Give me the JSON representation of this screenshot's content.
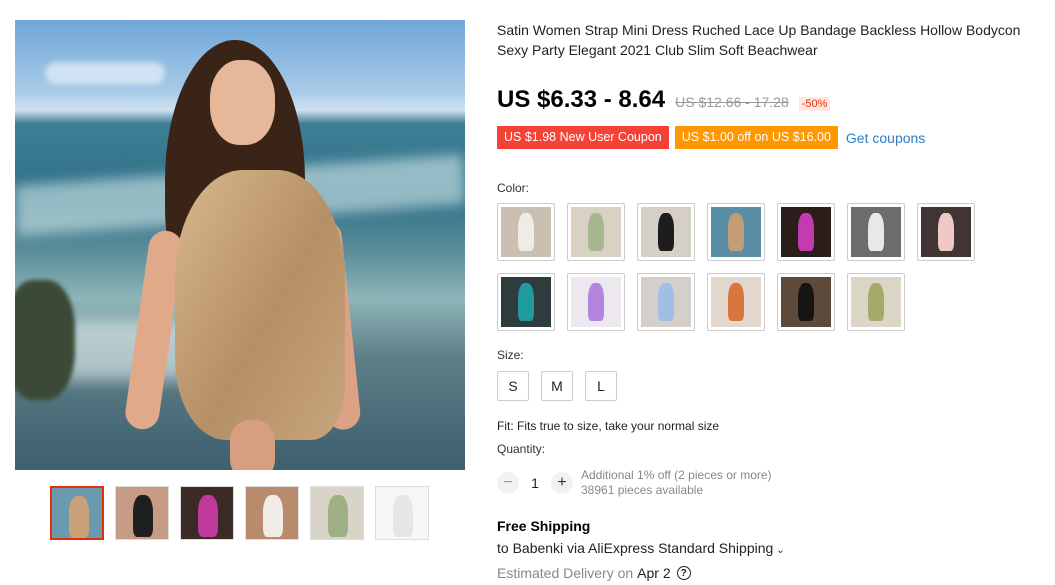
{
  "product": {
    "title": "Satin Women Strap Mini Dress Ruched Lace Up Bandage Backless Hollow Bodycon Sexy Party Elegant 2021 Club Slim Soft Beachwear",
    "price": "US $6.33 - 8.64",
    "original_price": "US $12.66 - 17.28",
    "discount": "-50%"
  },
  "coupons": {
    "new_user": "US $1.98 New User Coupon",
    "store": "US $1.00 off on US $16.00",
    "get_coupons": "Get coupons"
  },
  "gallery": {
    "thumbnails": [
      {
        "name": "champagne",
        "color": "#c9a27a",
        "bg": "#6a9ab0",
        "selected": true
      },
      {
        "name": "black-lounge",
        "color": "#1f1f1f",
        "bg": "#c79c86",
        "selected": false
      },
      {
        "name": "pink-night",
        "color": "#c03a9e",
        "bg": "#3b2a26",
        "selected": false
      },
      {
        "name": "white-room",
        "color": "#f1ece6",
        "bg": "#b98b6e",
        "selected": false
      },
      {
        "name": "sage",
        "color": "#9fb084",
        "bg": "#d8d4c8",
        "selected": false
      },
      {
        "name": "size-chart",
        "color": "#e6e6e6",
        "bg": "#f7f7f7",
        "selected": false
      }
    ]
  },
  "color": {
    "label": "Color:",
    "swatches": [
      {
        "name": "white",
        "color": "#efece6",
        "bg": "#cbbfb2"
      },
      {
        "name": "sage",
        "color": "#a8b88e",
        "bg": "#d9d2c4"
      },
      {
        "name": "black",
        "color": "#1d1d1d",
        "bg": "#d5cfc6"
      },
      {
        "name": "champagne-beach",
        "color": "#c29c74",
        "bg": "#5a8ea6"
      },
      {
        "name": "hot-pink",
        "color": "#c23bb0",
        "bg": "#2b1e1a"
      },
      {
        "name": "silver-white",
        "color": "#e8e8e8",
        "bg": "#6c6c6c"
      },
      {
        "name": "light-pink",
        "color": "#efc9c6",
        "bg": "#403532"
      },
      {
        "name": "teal",
        "color": "#1f9aa0",
        "bg": "#2f3b3d"
      },
      {
        "name": "lavender",
        "color": "#b184e0",
        "bg": "#ece8ee"
      },
      {
        "name": "light-blue",
        "color": "#9fc0e4",
        "bg": "#d4cfcb"
      },
      {
        "name": "orange",
        "color": "#d8753d",
        "bg": "#e1d7cd"
      },
      {
        "name": "black-party",
        "color": "#151515",
        "bg": "#5e4a3c"
      },
      {
        "name": "olive",
        "color": "#a4ab6b",
        "bg": "#dcd6c7"
      }
    ]
  },
  "size": {
    "label": "Size:",
    "options": [
      "S",
      "M",
      "L"
    ]
  },
  "fit_text": "Fit: Fits true to size, take your normal size",
  "quantity": {
    "label": "Quantity:",
    "minus": "−",
    "plus": "+",
    "value": "1",
    "additional": "Additional 1% off (2 pieces or more)",
    "available": "38961 pieces available"
  },
  "shipping": {
    "free": "Free Shipping",
    "to": "to Babenki via AliExpress Standard Shipping",
    "chevron": "⌄",
    "delivery_label": "Estimated Delivery on",
    "delivery_date": "Apr 2",
    "help": "?"
  }
}
